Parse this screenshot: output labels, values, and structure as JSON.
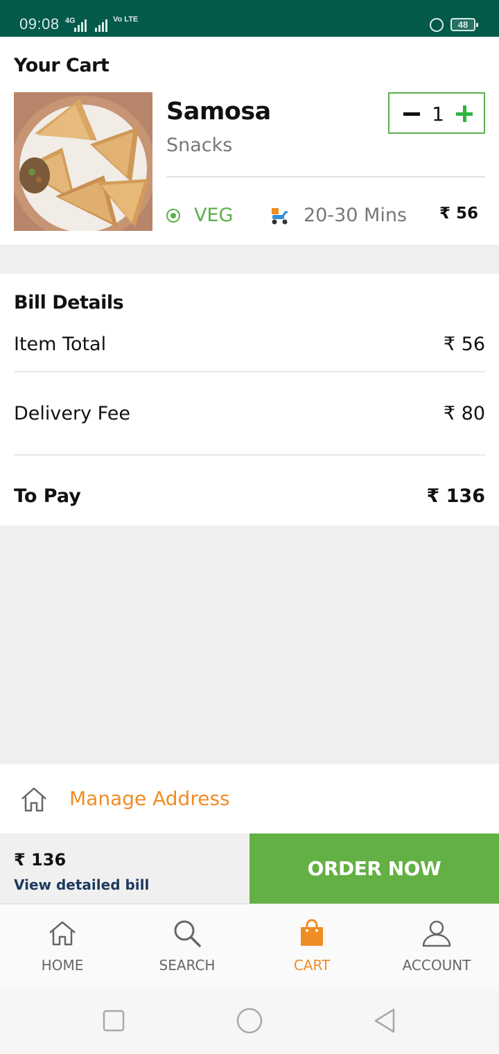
{
  "status_bar": {
    "time": "09:08",
    "network": "4G",
    "volte": "Vo LTE",
    "battery": "48"
  },
  "cart": {
    "title": "Your Cart",
    "item": {
      "name": "Samosa",
      "category": "Snacks",
      "quantity": "1",
      "diet_label": "VEG",
      "delivery_time": "20-30 Mins",
      "price": "₹ 56"
    }
  },
  "bill": {
    "title": "Bill Details",
    "item_total_label": "Item Total",
    "item_total_value": "₹ 56",
    "delivery_fee_label": "Delivery Fee",
    "delivery_fee_value": "₹ 80",
    "to_pay_label": "To Pay",
    "to_pay_value": "₹ 136"
  },
  "address": {
    "label": "Manage Address"
  },
  "order_bar": {
    "total": "₹ 136",
    "view_bill": "View detailed bill",
    "order_button": "ORDER NOW"
  },
  "bottom_nav": {
    "home": "HOME",
    "search": "SEARCH",
    "cart": "CART",
    "account": "ACCOUNT",
    "active": "cart"
  },
  "colors": {
    "status_bar": "#03594a",
    "veg_green": "#5ab04a",
    "order_button": "#63b044",
    "accent_orange": "#f08c24"
  }
}
